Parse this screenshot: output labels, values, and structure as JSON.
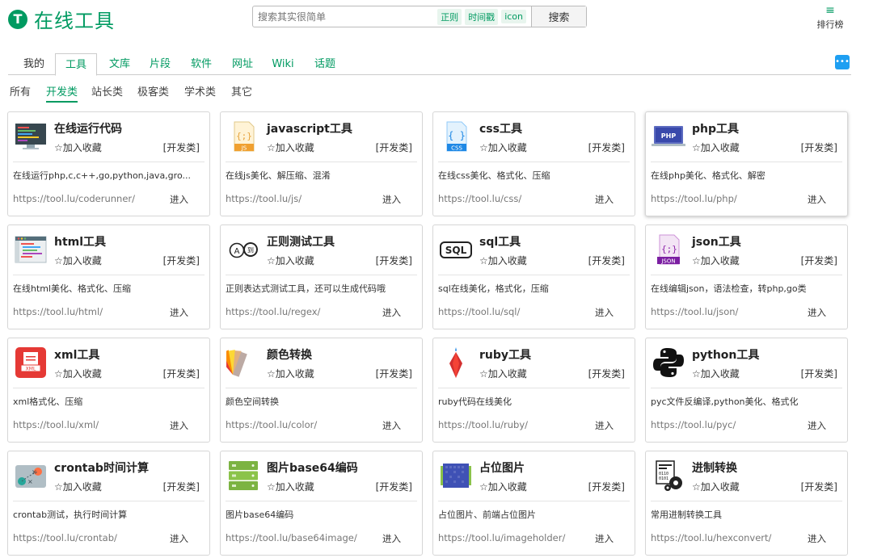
{
  "header": {
    "logo_letter": "T",
    "title": "在线工具",
    "search": {
      "placeholder": "搜索其实很简单",
      "tags": [
        "正则",
        "时间戳",
        "icon"
      ],
      "button": "搜索"
    },
    "rank": {
      "icon": "≡",
      "label": "排行榜"
    }
  },
  "nav": {
    "tabs": [
      "我的",
      "工具",
      "文库",
      "片段",
      "软件",
      "网址",
      "Wiki",
      "话题"
    ],
    "active": "工具",
    "chat_icon": "chat-bubble-icon"
  },
  "subnav": {
    "items": [
      "所有",
      "开发类",
      "站长类",
      "极客类",
      "学术类",
      "其它"
    ],
    "active": "开发类"
  },
  "common": {
    "fav": "☆加入收藏",
    "go": "进入"
  },
  "cards": [
    {
      "title": "在线运行代码",
      "category": "[开发类]",
      "desc": "在线运行php,c,c++,go,python,java,gro...",
      "url": "https://tool.lu/coderunner/",
      "icon": "code-runner-icon"
    },
    {
      "title": "javascript工具",
      "category": "[开发类]",
      "desc": "在线js美化、解压缩、混淆",
      "url": "https://tool.lu/js/",
      "icon": "js-file-icon"
    },
    {
      "title": "css工具",
      "category": "[开发类]",
      "desc": "在线css美化、格式化、压缩",
      "url": "https://tool.lu/css/",
      "icon": "css-file-icon"
    },
    {
      "title": "php工具",
      "category": "[开发类]",
      "desc": "在线php美化、格式化、解密",
      "url": "https://tool.lu/php/",
      "icon": "php-laptop-icon"
    },
    {
      "title": "html工具",
      "category": "[开发类]",
      "desc": "在线html美化、格式化、压缩",
      "url": "https://tool.lu/html/",
      "icon": "html-editor-icon"
    },
    {
      "title": "正则测试工具",
      "category": "[开发类]",
      "desc": "正则表达式测试工具，还可以生成代码哦",
      "url": "https://tool.lu/regex/",
      "icon": "regex-icon"
    },
    {
      "title": "sql工具",
      "category": "[开发类]",
      "desc": "sql在线美化，格式化，压缩",
      "url": "https://tool.lu/sql/",
      "icon": "sql-icon"
    },
    {
      "title": "json工具",
      "category": "[开发类]",
      "desc": "在线编辑json，语法检查，转php,go类",
      "url": "https://tool.lu/json/",
      "icon": "json-file-icon"
    },
    {
      "title": "xml工具",
      "category": "[开发类]",
      "desc": "xml格式化、压缩",
      "url": "https://tool.lu/xml/",
      "icon": "xml-file-icon"
    },
    {
      "title": "颜色转换",
      "category": "[开发类]",
      "desc": "颜色空间转换",
      "url": "https://tool.lu/color/",
      "icon": "color-palette-icon"
    },
    {
      "title": "ruby工具",
      "category": "[开发类]",
      "desc": "ruby代码在线美化",
      "url": "https://tool.lu/ruby/",
      "icon": "ruby-gem-icon"
    },
    {
      "title": "python工具",
      "category": "[开发类]",
      "desc": "pyc文件反编译,python美化、格式化",
      "url": "https://tool.lu/pyc/",
      "icon": "python-logo-icon"
    },
    {
      "title": "crontab时间计算",
      "category": "[开发类]",
      "desc": "crontab测试，执行时间计算",
      "url": "https://tool.lu/crontab/",
      "icon": "crontab-icon"
    },
    {
      "title": "图片base64编码",
      "category": "[开发类]",
      "desc": "图片base64编码",
      "url": "https://tool.lu/base64image/",
      "icon": "base64-image-icon"
    },
    {
      "title": "占位图片",
      "category": "[开发类]",
      "desc": "占位图片、前端占位图片",
      "url": "https://tool.lu/imageholder/",
      "icon": "placeholder-chip-icon"
    },
    {
      "title": "进制转换",
      "category": "[开发类]",
      "desc": "常用进制转换工具",
      "url": "https://tool.lu/hexconvert/",
      "icon": "hex-convert-icon"
    }
  ]
}
